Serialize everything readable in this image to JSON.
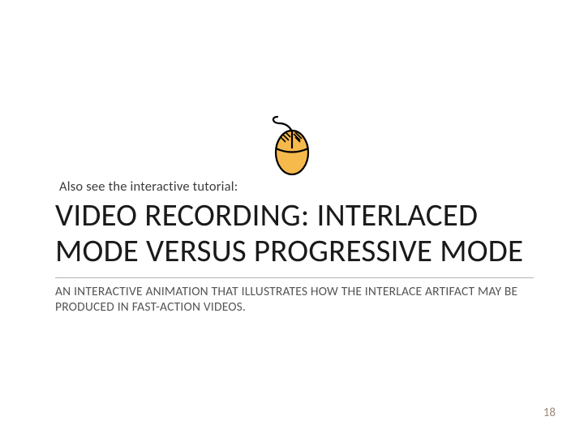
{
  "lead_in": "Also see the interactive tutorial:",
  "title": "VIDEO RECORDING: INTERLACED MODE VERSUS PROGRESSIVE MODE",
  "subtitle": "AN INTERACTIVE ANIMATION THAT ILLUSTRATES HOW THE INTERLACE ARTIFACT MAY BE PRODUCED IN FAST-ACTION VIDEOS.",
  "page_number": "18",
  "icon": "mouse-icon",
  "colors": {
    "mouse_fill": "#f6b94c",
    "mouse_stroke": "#000000",
    "cord": "#000000"
  }
}
